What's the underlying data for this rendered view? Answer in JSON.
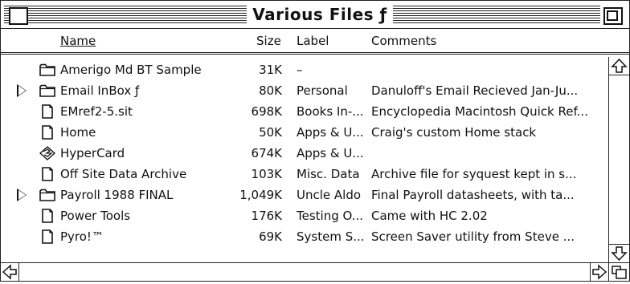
{
  "window": {
    "title": "Various Files ƒ"
  },
  "columns": {
    "name": "Name",
    "size": "Size",
    "label": "Label",
    "comments": "Comments"
  },
  "files": [
    {
      "icon": "folder-icon",
      "expandable": false,
      "name": "Amerigo Md BT Sample",
      "size": "31K",
      "label": "–",
      "comment": ""
    },
    {
      "icon": "folder-icon",
      "expandable": true,
      "name": "Email InBox ƒ",
      "size": "80K",
      "label": "Personal",
      "comment": "Danuloff's Email Recieved Jan-Ju..."
    },
    {
      "icon": "document-icon",
      "expandable": false,
      "name": "EMref2-5.sit",
      "size": "698K",
      "label": "Books In-...",
      "comment": "Encyclopedia Macintosh Quick Ref..."
    },
    {
      "icon": "document-icon",
      "expandable": false,
      "name": "Home",
      "size": "50K",
      "label": "Apps & U...",
      "comment": "Craig's custom Home stack"
    },
    {
      "icon": "hypercard-app-icon",
      "expandable": false,
      "name": "HyperCard",
      "size": "674K",
      "label": "Apps & U...",
      "comment": ""
    },
    {
      "icon": "document-icon",
      "expandable": false,
      "name": "Off Site Data Archive",
      "size": "103K",
      "label": "Misc. Data",
      "comment": "Archive file for syquest kept in s..."
    },
    {
      "icon": "folder-icon",
      "expandable": true,
      "name": "Payroll 1988 FINAL",
      "size": "1,049K",
      "label": "Uncle Aldo",
      "comment": "Final Payroll datasheets, with ta..."
    },
    {
      "icon": "document-icon",
      "expandable": false,
      "name": "Power Tools",
      "size": "176K",
      "label": "Testing O...",
      "comment": "Came with HC 2.02"
    },
    {
      "icon": "document-icon",
      "expandable": false,
      "name": "Pyro!™",
      "size": "69K",
      "label": "System S...",
      "comment": "Screen Saver utility from Steve ..."
    }
  ]
}
